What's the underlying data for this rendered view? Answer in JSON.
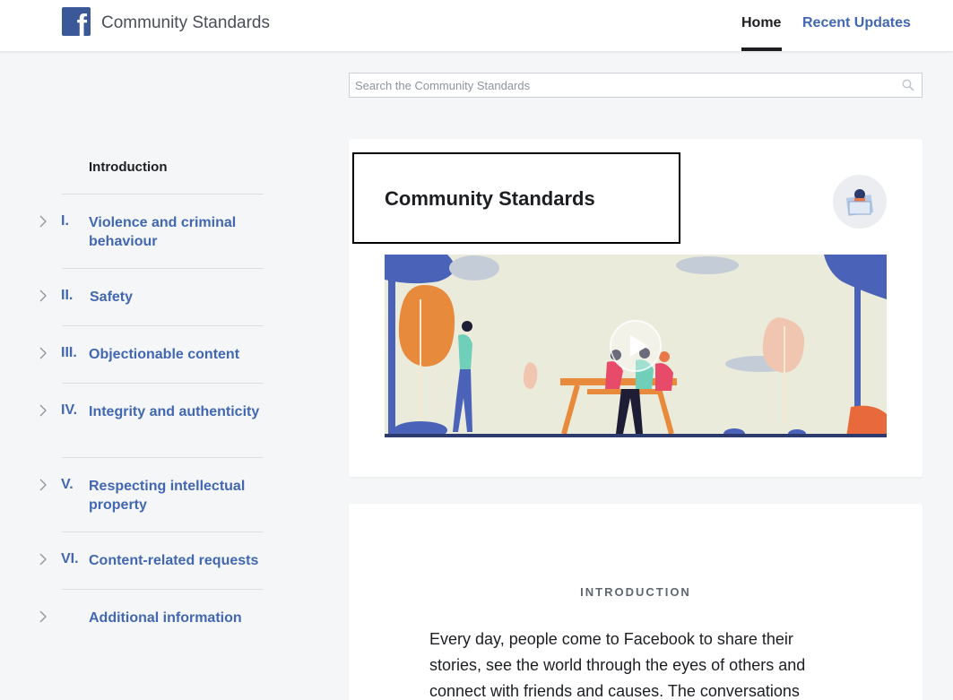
{
  "header": {
    "site_title": "Community Standards",
    "nav": {
      "home": "Home",
      "recent_updates": "Recent Updates"
    }
  },
  "search": {
    "placeholder": "Search the Community Standards"
  },
  "sidebar": {
    "intro": "Introduction",
    "items": [
      {
        "num": "I.",
        "label": "Violence and criminal behaviour"
      },
      {
        "num": "II.",
        "label": "Safety"
      },
      {
        "num": "III.",
        "label": "Objectionable content"
      },
      {
        "num": "IV.",
        "label": "Integrity and authenticity"
      },
      {
        "num": "V.",
        "label": "Respecting intellectual property"
      },
      {
        "num": "VI.",
        "label": "Content-related requests"
      },
      {
        "num": "",
        "label": "Additional information"
      }
    ]
  },
  "main": {
    "card_title": "Community Standards",
    "section_label": "INTRODUCTION",
    "intro_text": "Every day, people come to Facebook to share their stories, see the world through the eyes of others and connect with friends and causes. The conversations"
  },
  "colors": {
    "brand": "#3b5998",
    "link": "#4267b2",
    "background": "#f5f6f7"
  },
  "icons": {
    "logo": "facebook-logo-icon",
    "search": "search-icon",
    "chevron": "chevron-right-icon",
    "play": "play-icon"
  }
}
